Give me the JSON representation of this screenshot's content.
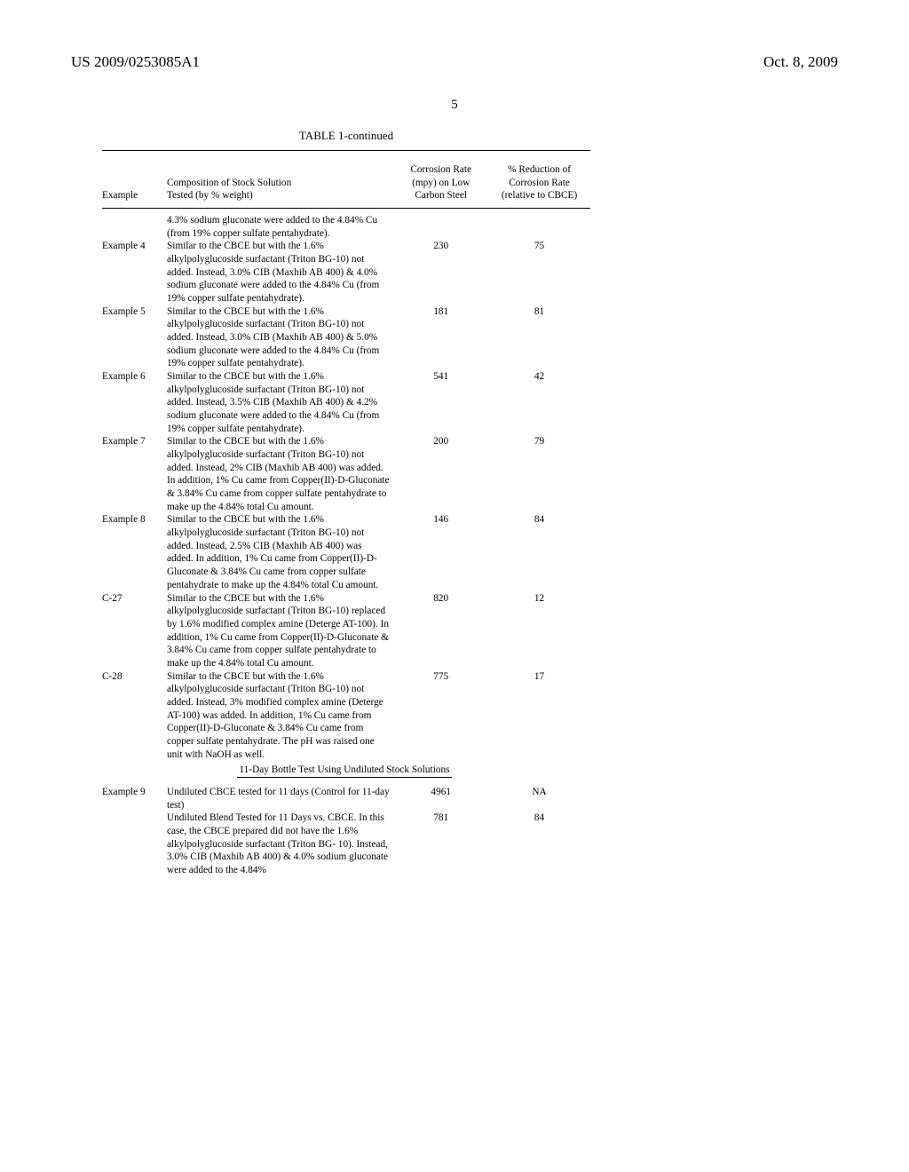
{
  "header": {
    "left": "US 2009/0253085A1",
    "right": "Oct. 8, 2009"
  },
  "page_number": "5",
  "table_caption": "TABLE 1-continued",
  "columns": {
    "c1": "Example",
    "c2a": "Composition of Stock Solution",
    "c2b": "Tested (by % weight)",
    "c3a": "Corrosion Rate",
    "c3b": "(mpy) on Low",
    "c3c": "Carbon Steel",
    "c4a": "% Reduction of",
    "c4b": "Corrosion Rate",
    "c4c": "(relative to CBCE)"
  },
  "rows": {
    "lead": "4.3% sodium gluconate were added to the 4.84% Cu (from 19% copper sulfate pentahydrate).",
    "e4": {
      "ex": "Example 4",
      "comp": "Similar to the CBCE but with the 1.6% alkylpolyglucoside surfactant (Triton BG-10) not added. Instead, 3.0% CIB (Maxhib AB 400) & 4.0% sodium gluconate were added to the 4.84% Cu (from 19% copper sulfate pentahydrate).",
      "rate": "230",
      "red": "75"
    },
    "e5": {
      "ex": "Example 5",
      "comp": "Similar to the CBCE but with the 1.6% alkylpolyglucoside surfactant (Triton BG-10) not added. Instead, 3.0% CIB (Maxhib AB 400) & 5.0% sodium gluconate were added to the 4.84% Cu (from 19% copper sulfate pentahydrate).",
      "rate": "181",
      "red": "81"
    },
    "e6": {
      "ex": "Example 6",
      "comp": "Similar to the CBCE but with the 1.6% alkylpolyglucoside surfactant (Triton BG-10) not added. Instead, 3.5% CIB (Maxhib AB 400) & 4.2% sodium gluconate were added to the 4.84% Cu (from 19% copper sulfate pentahydrate).",
      "rate": "541",
      "red": "42"
    },
    "e7": {
      "ex": "Example 7",
      "comp": "Similar to the CBCE but with the 1.6% alkylpolyglucoside surfactant (Triton BG-10) not added. Instead, 2% CIB (Maxhib AB 400) was added. In addition, 1% Cu came from Copper(II)-D-Gluconate & 3.84% Cu came from copper sulfate pentahydrate to make up the 4.84% total Cu amount.",
      "rate": "200",
      "red": "79"
    },
    "e8": {
      "ex": "Example 8",
      "comp": "Similar to the CBCE but with the 1.6% alkylpolyglucoside surfactant (Triton BG-10) not added. Instead, 2.5% CIB (Maxhib AB 400) was added. In addition, 1% Cu came from Copper(II)-D-Gluconate & 3.84% Cu came from copper sulfate pentahydrate to make up the 4.84% total Cu amount.",
      "rate": "146",
      "red": "84"
    },
    "c27": {
      "ex": "C-27",
      "comp": "Similar to the CBCE but with the 1.6% alkylpolyglucoside surfactant (Triton BG-10) replaced by 1.6% modified complex amine (Deterge AT-100). In addition, 1% Cu came from Copper(II)-D-Gluconate & 3.84% Cu came from copper sulfate pentahydrate to make up the 4.84% total Cu amount.",
      "rate": "820",
      "red": "12"
    },
    "c28": {
      "ex": "C-28",
      "comp": "Similar to the CBCE but with the 1.6% alkylpolyglucoside surfactant (Triton BG-10) not added. Instead, 3% modified complex amine (Deterge AT-100) was added. In addition, 1% Cu came from Copper(II)-D-Gluconate & 3.84% Cu came from copper sulfate pentahydrate. The pH was raised one unit with NaOH as well.",
      "rate": "775",
      "red": "17"
    },
    "section2": "11-Day Bottle Test Using Undiluted Stock Solutions",
    "e9a": {
      "ex": "Example 9",
      "comp": "Undiluted CBCE tested for 11 days (Control for 11-day test)",
      "rate": "4961",
      "red": "NA"
    },
    "e9b": {
      "comp": "Undiluted Blend Tested for 11 Days vs. CBCE. In this case, the CBCE prepared did not have the 1.6% alkylpolyglucoside surfactant (Triton BG- 10). Instead, 3.0% CIB (Maxhib AB 400) & 4.0% sodium gluconate were added to the 4.84%",
      "rate": "781",
      "red": "84"
    }
  }
}
